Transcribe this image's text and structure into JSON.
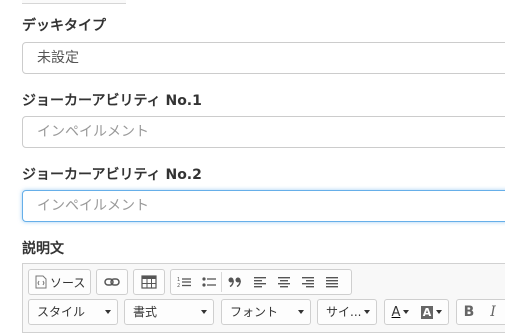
{
  "fields": [
    {
      "label": "デッキタイプ",
      "value": "未設定",
      "placeholder": ""
    },
    {
      "label": "ジョーカーアビリティ No.1",
      "value": "",
      "placeholder": "インペイルメント"
    },
    {
      "label": "ジョーカーアビリティ No.2",
      "value": "",
      "placeholder": "インペイルメント"
    }
  ],
  "description_label": "説明文",
  "editor": {
    "source_label": "ソース",
    "styles": [
      "スタイル",
      "書式",
      "フォント",
      "サイ..."
    ],
    "bold_label": "B",
    "italic_label": "I",
    "font_color_label": "A",
    "bg_color_label": "A"
  }
}
